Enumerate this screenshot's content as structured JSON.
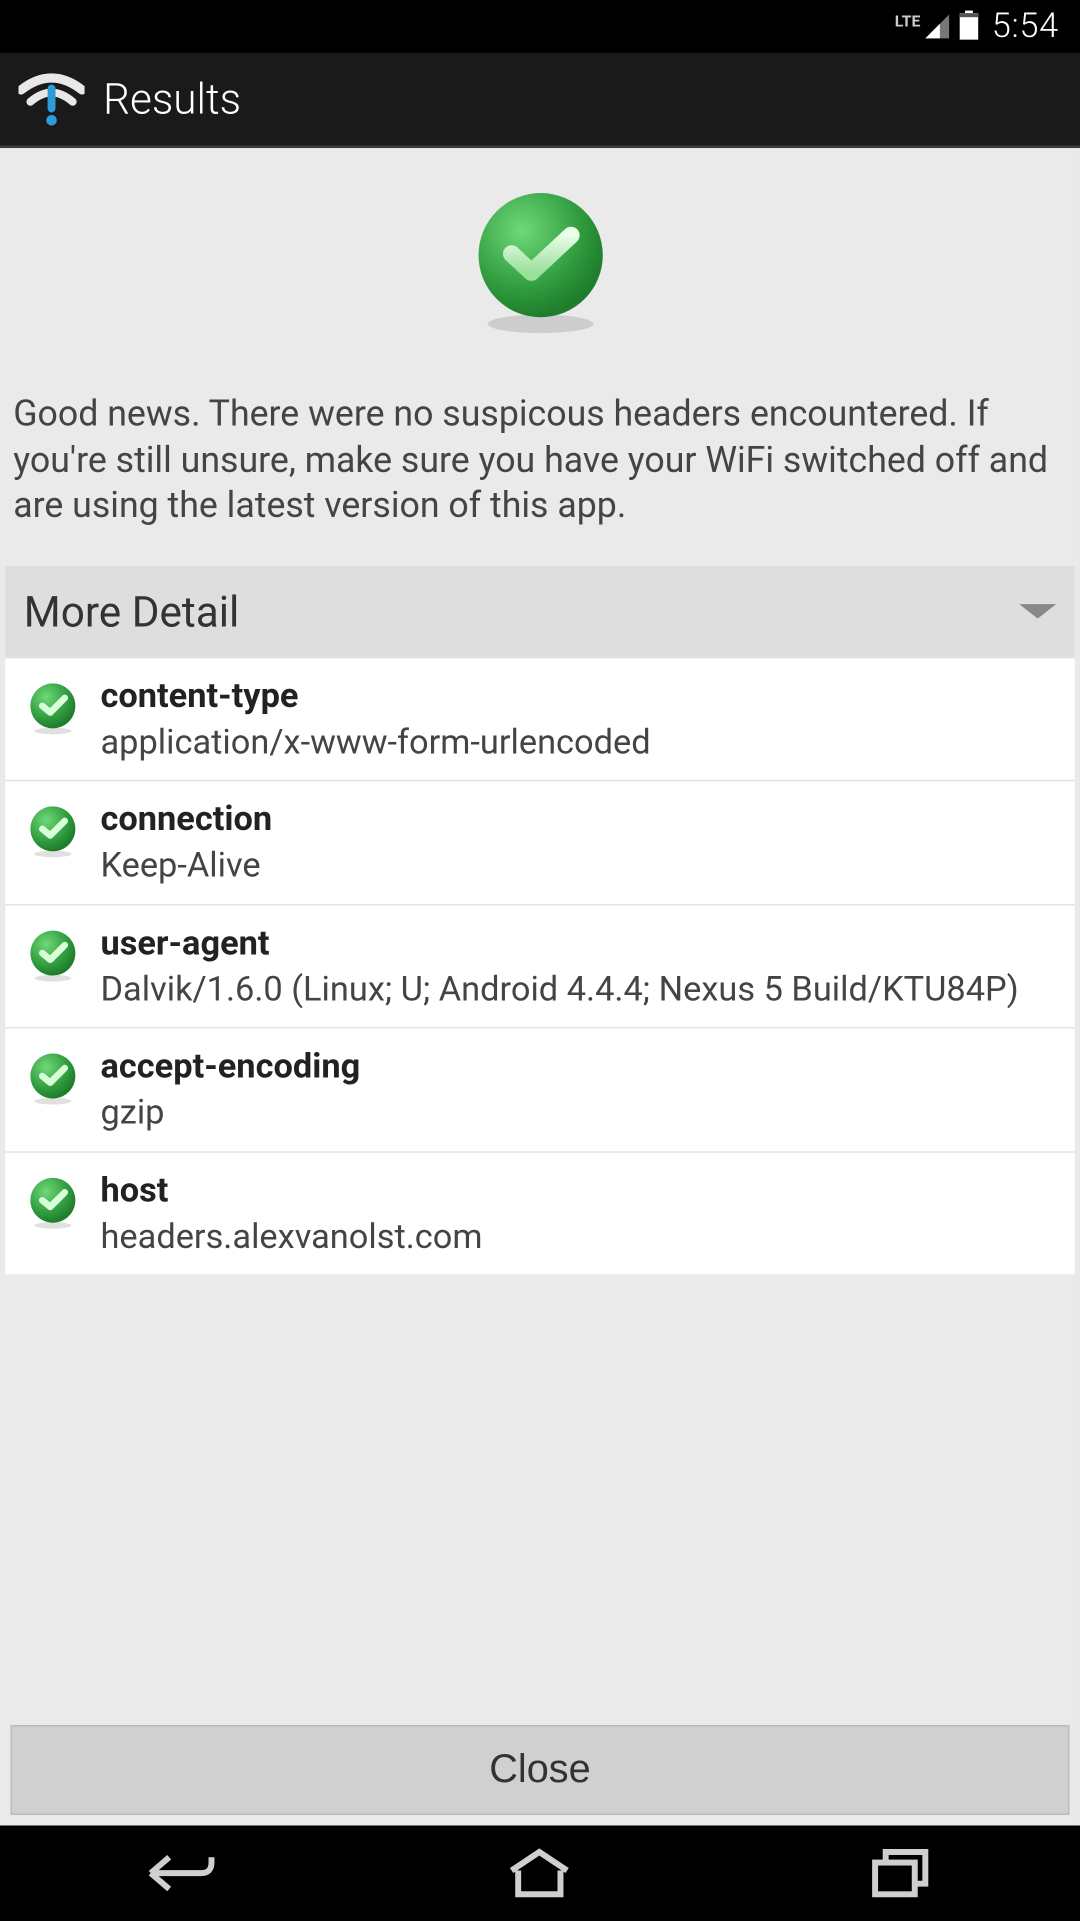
{
  "status_bar": {
    "network_label": "LTE",
    "time": "5:54"
  },
  "title_bar": {
    "title": "Results"
  },
  "hero": {
    "message": "Good news. There were no suspicous headers encountered. If you're still unsure, make sure you have your WiFi switched off and are using the latest version of this app."
  },
  "more_detail": {
    "label": "More Detail"
  },
  "details": [
    {
      "label": "content-type",
      "value": "application/x-www-form-urlencoded"
    },
    {
      "label": "connection",
      "value": "Keep-Alive"
    },
    {
      "label": "user-agent",
      "value": "Dalvik/1.6.0 (Linux; U; Android 4.4.4; Nexus 5 Build/KTU84P)"
    },
    {
      "label": "accept-encoding",
      "value": "gzip"
    },
    {
      "label": "host",
      "value": "headers.alexvanolst.com"
    }
  ],
  "close_button": {
    "label": "Close"
  },
  "colors": {
    "success_green": "#3fa547",
    "success_green_light": "#6fd878"
  }
}
